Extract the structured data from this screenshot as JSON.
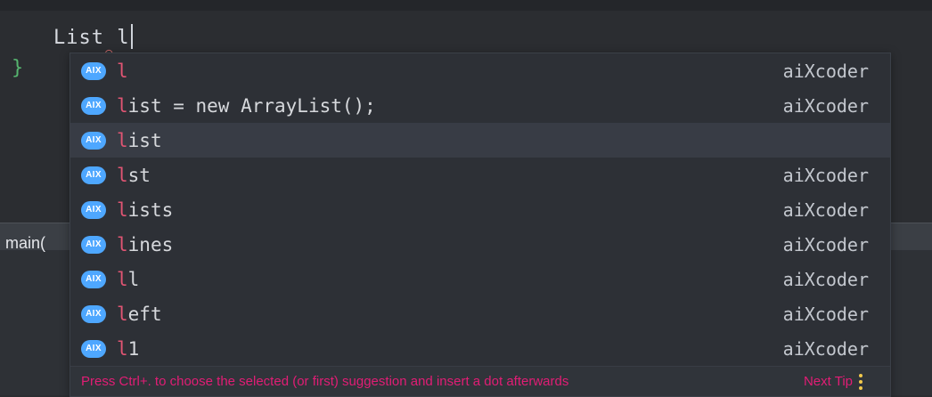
{
  "editor": {
    "code_text": "List l",
    "squiggle": "⌒",
    "brace": "}",
    "main_label": "main("
  },
  "popup": {
    "items": [
      {
        "prefix": "l",
        "rest": "",
        "source": "aiXcoder",
        "selected": false
      },
      {
        "prefix": "l",
        "rest": "ist = new ArrayList();",
        "source": "aiXcoder",
        "selected": false
      },
      {
        "prefix": "l",
        "rest": "ist",
        "source": "",
        "selected": true
      },
      {
        "prefix": "l",
        "rest": "st",
        "source": "aiXcoder",
        "selected": false
      },
      {
        "prefix": "l",
        "rest": "ists",
        "source": "aiXcoder",
        "selected": false
      },
      {
        "prefix": "l",
        "rest": "ines",
        "source": "aiXcoder",
        "selected": false
      },
      {
        "prefix": "l",
        "rest": "l",
        "source": "aiXcoder",
        "selected": false
      },
      {
        "prefix": "l",
        "rest": "eft",
        "source": "aiXcoder",
        "selected": false
      },
      {
        "prefix": "l",
        "rest": "1",
        "source": "aiXcoder",
        "selected": false
      }
    ],
    "icon_label": "AIX",
    "footer_text": "Press Ctrl+. to choose the selected (or first) suggestion and insert a dot afterwards",
    "footer_link": "Next Tip"
  },
  "colors": {
    "editor_bg": "#2b2d31",
    "popup_bg": "#2d3036",
    "selected_bg": "#383c45",
    "match": "#e05573",
    "footer": "#e11d75",
    "icon_bg": "#4ea7ff"
  },
  "icons": {
    "suggestion": "aixcoder-icon",
    "menu": "more-vertical-icon"
  }
}
